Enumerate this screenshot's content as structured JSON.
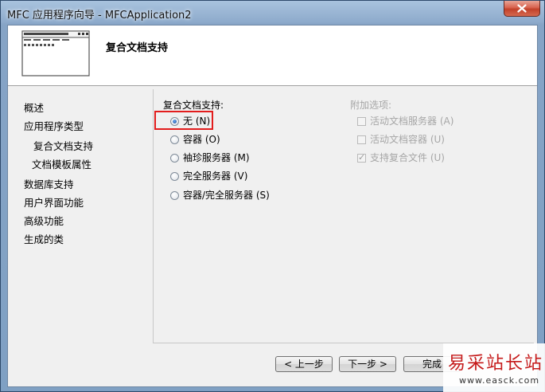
{
  "window": {
    "title": "MFC 应用程序向导 - MFCApplication2"
  },
  "header": {
    "title": "复合文档支持"
  },
  "nav": {
    "items": [
      {
        "label": "概述"
      },
      {
        "label": "应用程序类型"
      },
      {
        "label": "复合文档支持",
        "selected": true
      },
      {
        "label": "文档模板属性"
      },
      {
        "label": "数据库支持"
      },
      {
        "label": "用户界面功能"
      },
      {
        "label": "高级功能"
      },
      {
        "label": "生成的类"
      }
    ]
  },
  "compound": {
    "heading": "复合文档支持:",
    "options": [
      {
        "label": "无 (N)",
        "checked": true
      },
      {
        "label": "容器 (O)",
        "checked": false
      },
      {
        "label": "袖珍服务器 (M)",
        "checked": false
      },
      {
        "label": "完全服务器 (V)",
        "checked": false
      },
      {
        "label": "容器/完全服务器 (S)",
        "checked": false
      }
    ]
  },
  "additional": {
    "heading": "附加选项:",
    "options": [
      {
        "label": "活动文档服务器 (A)",
        "checked": false,
        "enabled": false
      },
      {
        "label": "活动文档容器 (U)",
        "checked": false,
        "enabled": false
      },
      {
        "label": "支持复合文件 (U)",
        "checked": true,
        "enabled": false
      }
    ]
  },
  "buttons": {
    "back": "< 上一步",
    "next": "下一步 >",
    "finish": "完成"
  },
  "watermark": {
    "brand": "易采站长站",
    "url": "www.easck.com"
  },
  "colors": {
    "highlight": "#e21d1d",
    "title_bar": "#8eabcc"
  }
}
